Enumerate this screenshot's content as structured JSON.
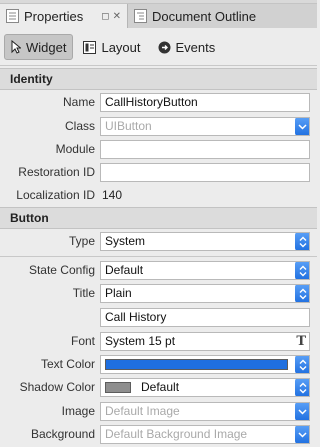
{
  "tabs": {
    "properties_label": "Properties",
    "document_outline_label": "Document Outline"
  },
  "toolbar": {
    "widget_label": "Widget",
    "layout_label": "Layout",
    "events_label": "Events"
  },
  "identity": {
    "header": "Identity",
    "name_label": "Name",
    "name_value": "CallHistoryButton",
    "class_label": "Class",
    "class_placeholder": "UIButton",
    "module_label": "Module",
    "module_value": "",
    "restoration_label": "Restoration ID",
    "restoration_value": "",
    "localization_label": "Localization ID",
    "localization_value": "140"
  },
  "button": {
    "header": "Button",
    "type_label": "Type",
    "type_value": "System",
    "state_config_label": "State Config",
    "state_config_value": "Default",
    "title_label": "Title",
    "title_mode_value": "Plain",
    "title_text_value": "Call History",
    "font_label": "Font",
    "font_value": "System 15 pt",
    "text_color_label": "Text Color",
    "shadow_color_label": "Shadow Color",
    "shadow_color_value": "Default",
    "image_label": "Image",
    "image_placeholder": "Default Image",
    "background_label": "Background",
    "background_placeholder": "Default Background Image"
  },
  "colors": {
    "accent": "#1f6fe0",
    "text_color_swatch": "#1f6fe0",
    "shadow_color_swatch": "#8e8e8e"
  },
  "icons": [
    "properties-icon",
    "pin-icon",
    "close-icon",
    "outline-icon",
    "cursor-icon",
    "layout-icon",
    "events-icon",
    "font-icon",
    "chevron-updown-icon",
    "chevron-down-icon"
  ]
}
